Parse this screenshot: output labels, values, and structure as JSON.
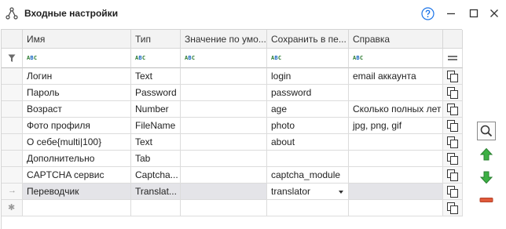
{
  "window": {
    "title": "Входные настройки",
    "app_icon": "graph-nodes-icon",
    "help_icon": "question-circle-icon",
    "minimize_icon": "minimize-icon",
    "maximize_icon": "maximize-icon",
    "close_icon": "close-icon"
  },
  "grid": {
    "columns": [
      "Имя",
      "Тип",
      "Значение по умо...",
      "Сохранить в пе...",
      "Справка"
    ],
    "filter_placeholder": "abc",
    "rows": [
      {
        "name": "Логин",
        "type": "Text",
        "value": "",
        "save_to": "login",
        "help": "email аккаунта"
      },
      {
        "name": "Пароль",
        "type": "Password",
        "value": "",
        "save_to": "password",
        "help": ""
      },
      {
        "name": "Возраст",
        "type": "Number",
        "value": "",
        "save_to": "age",
        "help": "Сколько полных лет"
      },
      {
        "name": "Фото профиля",
        "type": "FileName",
        "value": "",
        "save_to": "photo",
        "help": "jpg, png, gif"
      },
      {
        "name": "О себе{multi|100}",
        "type": "Text",
        "value": "",
        "save_to": "about",
        "help": ""
      },
      {
        "name": "Дополнительно",
        "type": "Tab",
        "value": "",
        "save_to": "",
        "help": ""
      },
      {
        "name": "CAPTCHA сервис",
        "type": "Captcha...",
        "value": "",
        "save_to": "captcha_module",
        "help": ""
      },
      {
        "name": "Переводчик",
        "type": "Translat...",
        "value": "",
        "save_to": "translator",
        "help": ""
      }
    ],
    "selected_row_marker": "→",
    "new_row_marker": "✱"
  },
  "side_buttons": {
    "search": "search-icon",
    "move_up": "arrow-up-icon",
    "move_down": "arrow-down-icon",
    "remove": "minus-icon"
  },
  "colors": {
    "accent_green": "#3cb043",
    "remove_red": "#e05a3a",
    "selected_row_bg": "#e4e4e8",
    "help_blue": "#1a73e8"
  }
}
